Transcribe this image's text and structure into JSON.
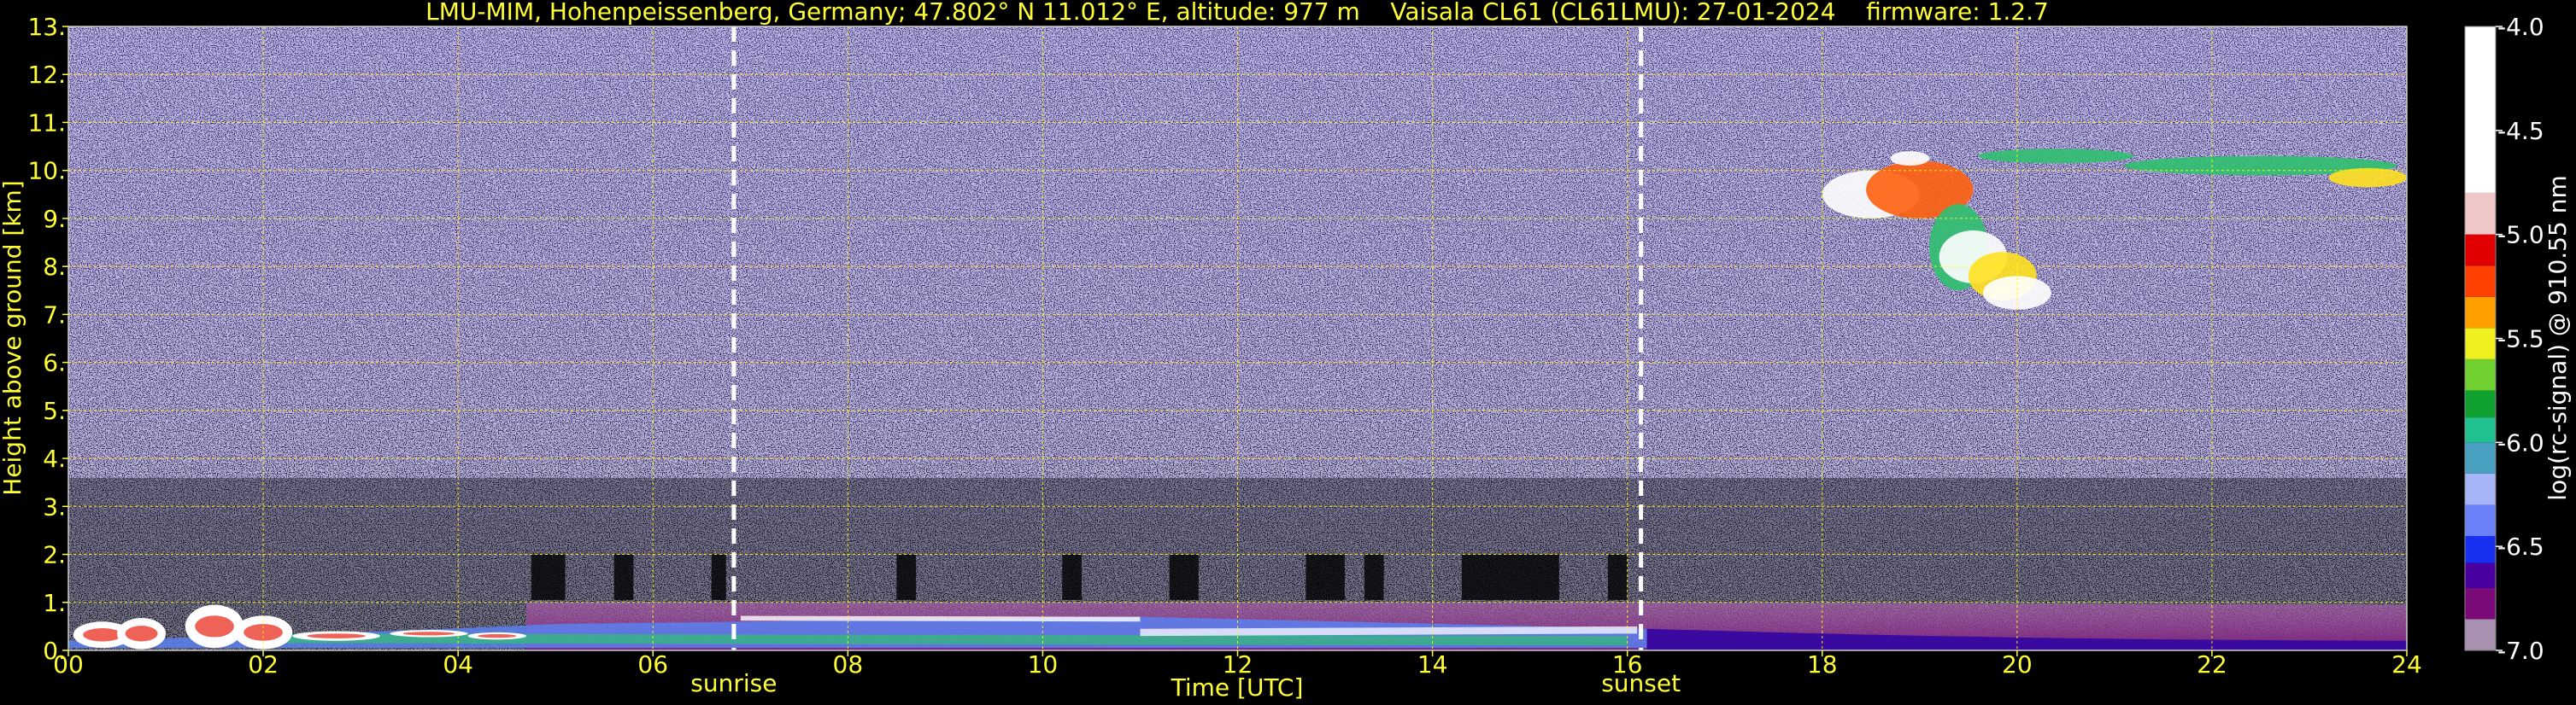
{
  "chart_data": {
    "type": "heatmap",
    "title": "LMU-MIM, Hohenpeissenberg, Germany; 47.802° N 11.012° E, altitude: 977 m    Vaisala CL61 (CL61LMU): 27-01-2024    firmware: 1.2.7",
    "xlabel": "Time [UTC]",
    "ylabel": "Height above ground [km]",
    "xlim": [
      0,
      24
    ],
    "ylim": [
      0,
      13
    ],
    "x_ticks": [
      0,
      2,
      4,
      6,
      8,
      10,
      12,
      14,
      16,
      18,
      20,
      22,
      24
    ],
    "x_tick_labels": [
      "00",
      "02",
      "04",
      "06",
      "08",
      "10",
      "12",
      "14",
      "16",
      "18",
      "20",
      "22",
      "24"
    ],
    "y_ticks": [
      0,
      1,
      2,
      3,
      4,
      5,
      6,
      7,
      8,
      9,
      10,
      11,
      12,
      13
    ],
    "y_tick_labels": [
      "0.",
      "1.",
      "2.",
      "3.",
      "4.",
      "5.",
      "6.",
      "7.",
      "8.",
      "9.",
      "10.",
      "11.",
      "12.",
      "13."
    ],
    "grid": true,
    "grid_color": "#ffff00",
    "background_color": "#000000",
    "markers": [
      {
        "label": "sunrise",
        "x": 6.83
      },
      {
        "label": "sunset",
        "x": 16.14
      }
    ],
    "colorbar": {
      "label": "log(rc-signal) @ 910.55 nm",
      "range": [
        -7.0,
        -4.0
      ],
      "ticks": [
        -7.0,
        -6.5,
        -6.0,
        -5.5,
        -5.0,
        -4.5,
        -4.0
      ],
      "tick_labels": [
        "-7.0",
        "-6.5",
        "-6.0",
        "-5.5",
        "-5.0",
        "-4.5",
        "-4.0"
      ],
      "colors": [
        {
          "from": -7.0,
          "to": -6.85,
          "color": "#a890b0"
        },
        {
          "from": -6.85,
          "to": -6.7,
          "color": "#7a0a78"
        },
        {
          "from": -6.7,
          "to": -6.58,
          "color": "#4a00a0"
        },
        {
          "from": -6.58,
          "to": -6.45,
          "color": "#1a30f0"
        },
        {
          "from": -6.45,
          "to": -6.3,
          "color": "#6a80f8"
        },
        {
          "from": -6.3,
          "to": -6.15,
          "color": "#a8b4f8"
        },
        {
          "from": -6.15,
          "to": -6.0,
          "color": "#4aa0c0"
        },
        {
          "from": -6.0,
          "to": -5.88,
          "color": "#20c090"
        },
        {
          "from": -5.88,
          "to": -5.75,
          "color": "#10a030"
        },
        {
          "from": -5.75,
          "to": -5.6,
          "color": "#70d030"
        },
        {
          "from": -5.6,
          "to": -5.45,
          "color": "#f0f020"
        },
        {
          "from": -5.45,
          "to": -5.3,
          "color": "#ffa000"
        },
        {
          "from": -5.3,
          "to": -5.15,
          "color": "#ff4000"
        },
        {
          "from": -5.15,
          "to": -5.0,
          "color": "#e00000"
        },
        {
          "from": -5.0,
          "to": -4.8,
          "color": "#f0c8c8"
        },
        {
          "from": -4.8,
          "to": -4.0,
          "color": "#ffffff"
        }
      ]
    }
  }
}
